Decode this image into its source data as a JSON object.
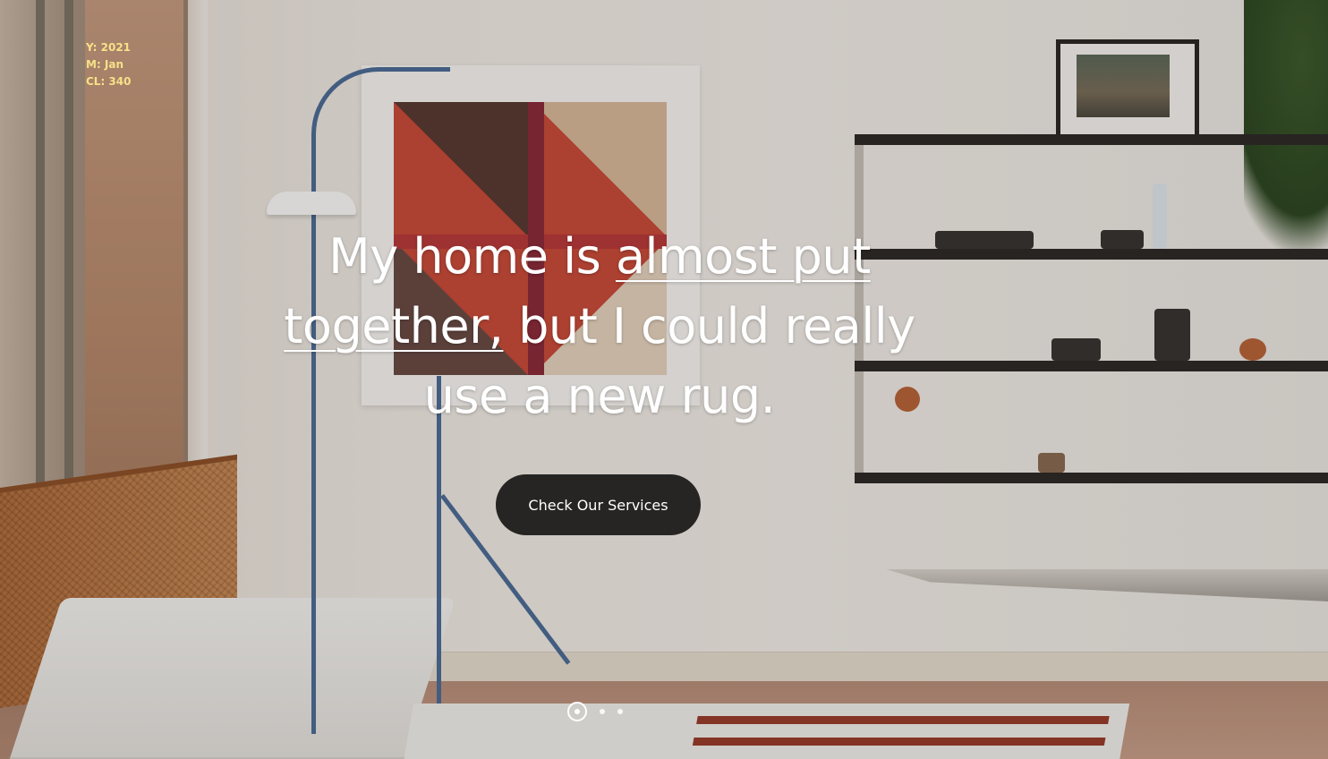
{
  "meta": {
    "year": "Y: 2021",
    "month": "M: Jan",
    "cl": "CL: 340"
  },
  "hero": {
    "headline_part1": "My home is ",
    "headline_underlined": "almost put together,",
    "headline_part2": " but I could really use a new rug.",
    "cta_label": "Check Our Services"
  },
  "slider": {
    "slide_count": 3,
    "active_index": 0
  }
}
